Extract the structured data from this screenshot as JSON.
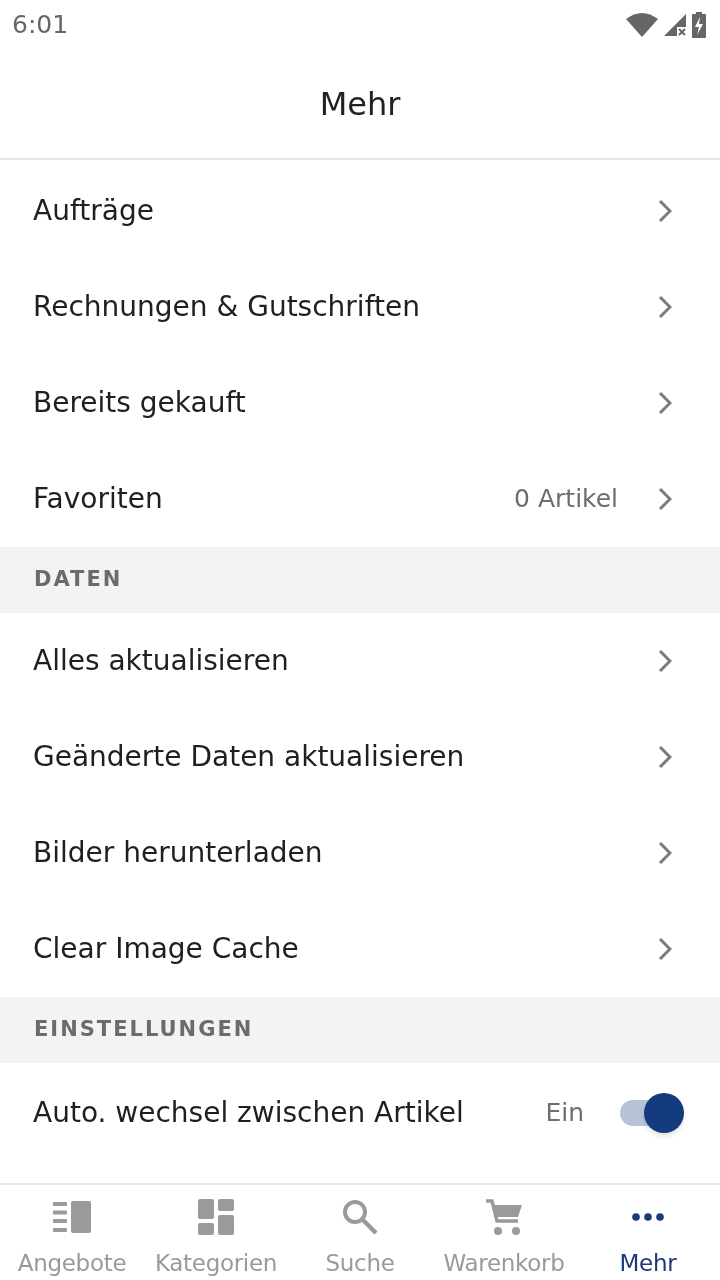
{
  "status_bar": {
    "time": "6:01"
  },
  "header": {
    "title": "Mehr"
  },
  "sections": [
    {
      "items": [
        {
          "kind": "link",
          "label": "Aufträge"
        },
        {
          "kind": "link",
          "label": "Rechnungen & Gutschriften"
        },
        {
          "kind": "link",
          "label": "Bereits gekauft"
        },
        {
          "kind": "link",
          "label": "Favoriten",
          "value": "0 Artikel"
        }
      ]
    },
    {
      "title": "DATEN",
      "items": [
        {
          "kind": "link",
          "label": "Alles aktualisieren"
        },
        {
          "kind": "link",
          "label": "Geänderte Daten aktualisieren"
        },
        {
          "kind": "link",
          "label": "Bilder herunterladen"
        },
        {
          "kind": "link",
          "label": "Clear Image Cache"
        }
      ]
    },
    {
      "title": "EINSTELLUNGEN",
      "items": [
        {
          "kind": "toggle",
          "label": "Auto. wechsel zwischen Artikel",
          "value": "Ein",
          "on": true
        }
      ]
    }
  ],
  "bottom_nav": [
    {
      "label": "Angebote",
      "selected": false
    },
    {
      "label": "Kategorien",
      "selected": false
    },
    {
      "label": "Suche",
      "selected": false
    },
    {
      "label": "Warenkorb",
      "selected": false
    },
    {
      "label": "Mehr",
      "selected": true
    }
  ]
}
